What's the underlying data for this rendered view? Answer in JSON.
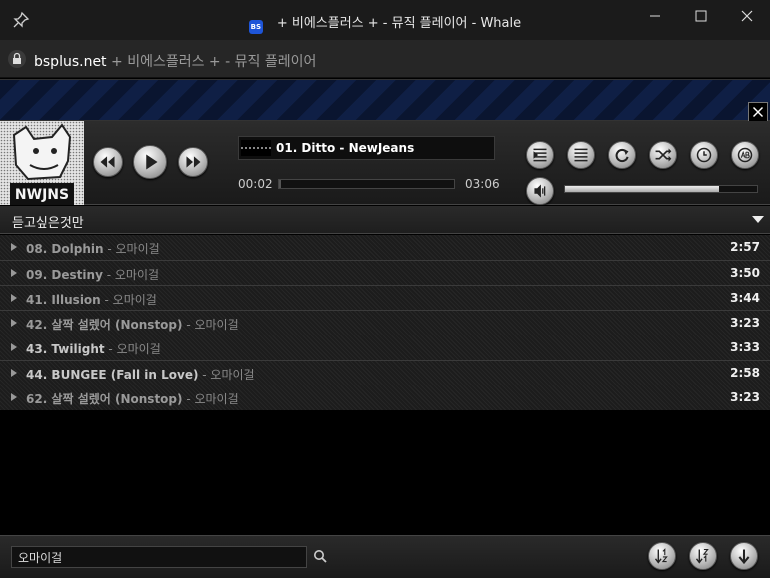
{
  "window": {
    "title": "+ 비에스플러스 + - 뮤직 플레이어 - Whale",
    "favicon_label": "BS"
  },
  "address": {
    "domain": "bsplus.net",
    "title": "+ 비에스플러스 + - 뮤직 플레이어"
  },
  "player": {
    "now_playing": "01. Ditto - NewJeans",
    "album_text": "NWJNS",
    "current_time": "00:02",
    "total_time": "03:06",
    "progress": 0.01,
    "volume": 0.8
  },
  "playlist": {
    "name": "듣고싶은것만",
    "tracks": [
      {
        "title": "08. Dolphin",
        "artist": " - 오마이걸",
        "duration": "2:57"
      },
      {
        "title": "09. Destiny",
        "artist": " - 오마이걸",
        "duration": "3:50"
      },
      {
        "title": "41. Illusion",
        "artist": " - 오마이걸",
        "duration": "3:44"
      },
      {
        "title": "42. 살짝 설렜어 (Nonstop)",
        "artist": " - 오마이걸",
        "duration": "3:23"
      },
      {
        "title": "43. Twilight",
        "artist": " - 오마이걸",
        "duration": "3:33"
      },
      {
        "title": "44. BUNGEE (Fall in Love)",
        "artist": " - 오마이걸",
        "duration": "2:58"
      },
      {
        "title": "62. 살짝 설렜어 (Nonstop)",
        "artist": " - 오마이걸",
        "duration": "3:23"
      }
    ]
  },
  "search": {
    "value": "오마이걸"
  },
  "colors": {
    "background": "#000000",
    "panel": "#262626",
    "accent_text": "#ffffff"
  }
}
